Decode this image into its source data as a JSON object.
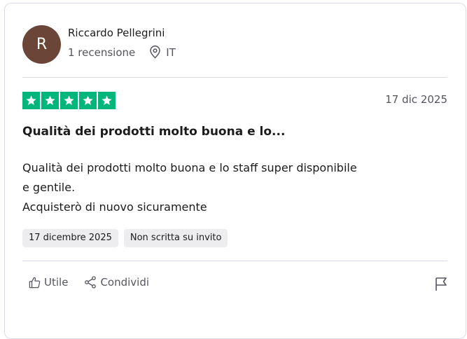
{
  "reviewer": {
    "initial": "R",
    "name": "Riccardo Pellegrini",
    "review_count": "1 recensione",
    "country": "IT",
    "avatar_color": "#6b4538"
  },
  "review": {
    "rating": 5,
    "date_short": "17 dic 2025",
    "title": "Qualità dei prodotti molto buona e lo...",
    "body_lines": [
      "Qualità dei prodotti molto buona e lo staff super disponibile",
      "e gentile.",
      "Acquisterò di nuovo sicuramente"
    ],
    "tags": [
      "17 dicembre 2025",
      "Non scritta su invito"
    ]
  },
  "actions": {
    "useful_label": "Utile",
    "share_label": "Condividi"
  },
  "icons": {
    "location": "location-pin-icon",
    "thumb": "thumbs-up-icon",
    "share": "share-icon",
    "flag": "flag-icon",
    "star": "star-icon"
  },
  "colors": {
    "star_green": "#00b67a",
    "muted_text": "#555560",
    "tag_bg": "#ededf0"
  }
}
